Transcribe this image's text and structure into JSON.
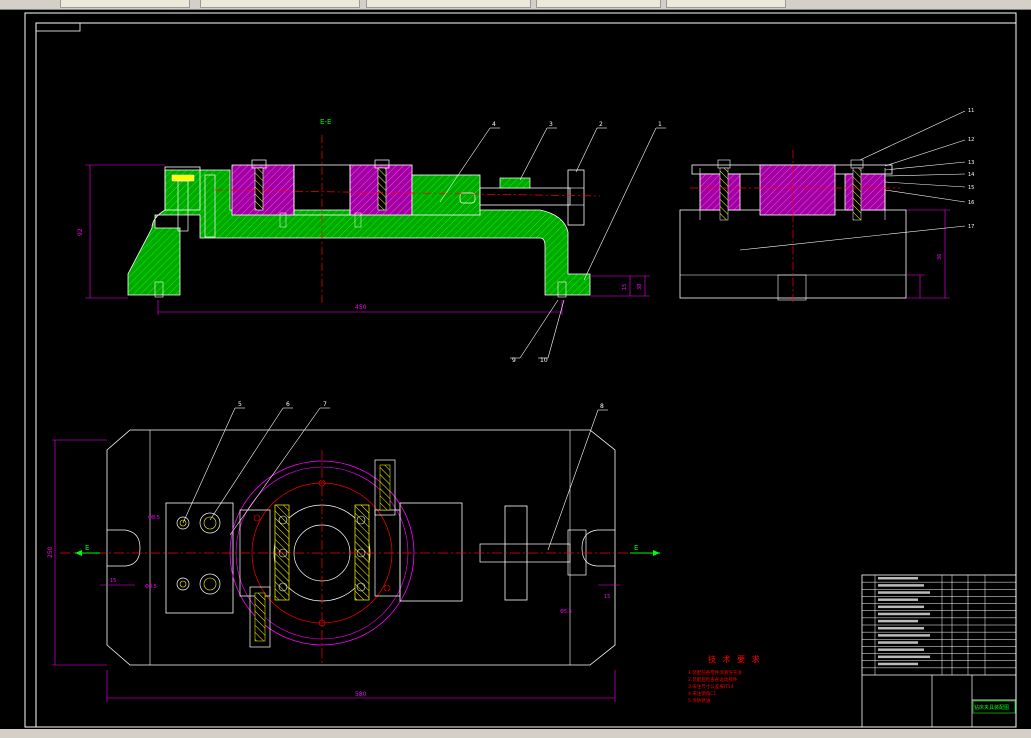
{
  "view_labels": {
    "section": "E-E"
  },
  "balloons": {
    "front": [
      "4",
      "3",
      "2",
      "1"
    ],
    "front_bottom": [
      "9",
      "10"
    ],
    "side": [
      "11",
      "12",
      "13",
      "14",
      "15",
      "16",
      "17"
    ],
    "top": [
      "5",
      "6",
      "7",
      "8"
    ]
  },
  "section_marks": {
    "left": "E",
    "right": "E"
  },
  "dimensions": {
    "front_height": "92",
    "front_width": "450",
    "front_right_a": "15",
    "front_right_b": "38",
    "side_height": "36",
    "top_height": "250",
    "top_width": "580",
    "top_left_offset": "15",
    "top_right_offset": "15",
    "hole_a": "Φ8.5",
    "hole_b": "Φ8.5",
    "hole_c": "Φ5.5"
  },
  "tech_requirements": {
    "title": "技 术 要 求",
    "lines": [
      "1.装配前各零件须清洗干净",
      "2.装配后检查各运动部件",
      "3.未注尺寸公差按IT14",
      "4.未注倒角C1",
      "5.涂防锈油"
    ]
  },
  "title_block": {
    "drawing_name": "钻床夹具装配图"
  },
  "colors": {
    "background": "#000000",
    "outline": "#ffffff",
    "section_fill": "#00b000",
    "dimension": "#ff00ff",
    "centerline": "#ff0000",
    "leader": "#ffffff",
    "title_block_accent": "#00ff00"
  }
}
